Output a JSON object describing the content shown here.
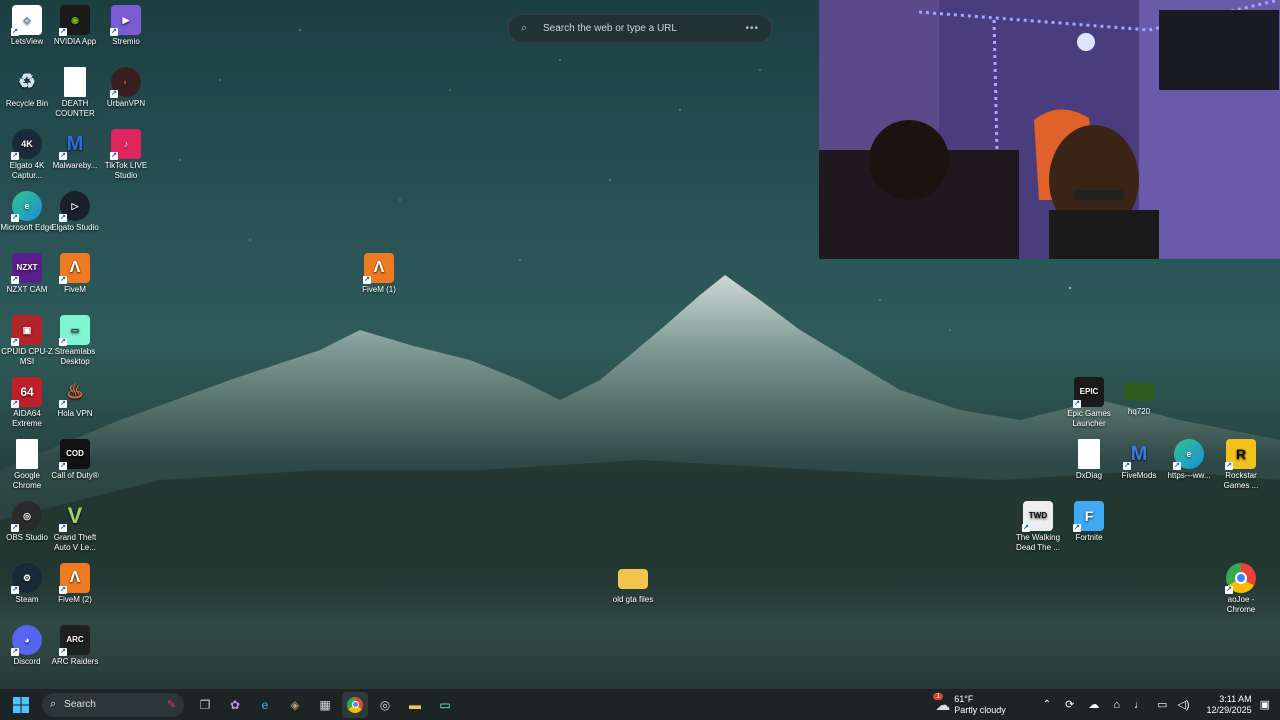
{
  "browser_search": {
    "placeholder": "Search the web or type a URL"
  },
  "desktop_icons": [
    {
      "id": "letsview",
      "label": "LetsView",
      "color": "#ffffff",
      "glyph": "◇"
    },
    {
      "id": "nvidia-app",
      "label": "NVIDIA App",
      "color": "#76b900",
      "glyph": "◉"
    },
    {
      "id": "stremio",
      "label": "Stremio",
      "color": "#7b5bd6",
      "glyph": "▶"
    },
    {
      "id": "recycle-bin",
      "label": "Recycle Bin",
      "color": "#9fb7c4",
      "glyph": "♻"
    },
    {
      "id": "death-counter",
      "label": "DEATH COUNTER",
      "color": "#ffffff",
      "glyph": ""
    },
    {
      "id": "urbanvpn",
      "label": "UrbanVPN",
      "color": "#3a1f1f",
      "glyph": "◐"
    },
    {
      "id": "elgato-4k",
      "label": "Elgato 4K Captur...",
      "color": "#1b2a3a",
      "glyph": "4K"
    },
    {
      "id": "malwarebytes",
      "label": "Malwareby...",
      "color": "#1f5bd6",
      "glyph": "M"
    },
    {
      "id": "tiktok-live",
      "label": "TikTok LIVE Studio",
      "color": "#e0245e",
      "glyph": "♪"
    },
    {
      "id": "microsoft-edge",
      "label": "Microsoft Edge",
      "color": "#1a8fd6",
      "glyph": "e"
    },
    {
      "id": "elgato-studio",
      "label": "Elgato Studio",
      "color": "#1b1f2a",
      "glyph": "▷"
    },
    {
      "id": "nzxt-cam",
      "label": "NZXT CAM",
      "color": "#5a1f8a",
      "glyph": "NZXT"
    },
    {
      "id": "fivem",
      "label": "FiveM",
      "color": "#f07a22",
      "glyph": "Λ"
    },
    {
      "id": "cpuid",
      "label": "CPUID CPU-Z MSI",
      "color": "#b2242a",
      "glyph": "▣"
    },
    {
      "id": "streamlabs",
      "label": "Streamlabs Desktop",
      "color": "#80f5d2",
      "glyph": "▭"
    },
    {
      "id": "aida64",
      "label": "AIDA64 Extreme",
      "color": "#c0202a",
      "glyph": "64"
    },
    {
      "id": "hola-vpn",
      "label": "Hola VPN",
      "color": "#f2683a",
      "glyph": "♨"
    },
    {
      "id": "google-chrome",
      "label": "Google Chrome",
      "color": "#ffffff",
      "glyph": ""
    },
    {
      "id": "call-of-duty",
      "label": "Call of Duty®",
      "color": "#111111",
      "glyph": "COD"
    },
    {
      "id": "obs-studio",
      "label": "OBS Studio",
      "color": "#2a2a2a",
      "glyph": "◎"
    },
    {
      "id": "gta-v",
      "label": "Grand Theft Auto V Le...",
      "color": "#1b2a1b",
      "glyph": "V"
    },
    {
      "id": "steam",
      "label": "Steam",
      "color": "#1b2838",
      "glyph": "⚙"
    },
    {
      "id": "fivem-2",
      "label": "FiveM (2)",
      "color": "#f07a22",
      "glyph": "Λ"
    },
    {
      "id": "discord",
      "label": "Discord",
      "color": "#5865f2",
      "glyph": "◕"
    },
    {
      "id": "arc-raiders",
      "label": "ARC Raiders",
      "color": "#202020",
      "glyph": "ARC"
    },
    {
      "id": "fivem-1",
      "label": "FiveM (1)",
      "color": "#f07a22",
      "glyph": "Λ"
    },
    {
      "id": "old-gta-files",
      "label": "old gta files",
      "color": "#f3c350",
      "glyph": ""
    },
    {
      "id": "epic-games",
      "label": "Epic Games Launcher",
      "color": "#1a1a1a",
      "glyph": "EPIC"
    },
    {
      "id": "hq720",
      "label": "hq720",
      "color": "#2e5a1c",
      "glyph": ""
    },
    {
      "id": "dxdiag",
      "label": "DxDiag",
      "color": "#ffffff",
      "glyph": ""
    },
    {
      "id": "fivemods",
      "label": "FiveMods",
      "color": "#2255cc",
      "glyph": "M"
    },
    {
      "id": "edge-url",
      "label": "https---ww...",
      "color": "#1a8fd6",
      "glyph": "e"
    },
    {
      "id": "rockstar",
      "label": "Rockstar Games ...",
      "color": "#f2c21a",
      "glyph": "R"
    },
    {
      "id": "walking-dead",
      "label": "The Walking Dead The ...",
      "color": "#eeeeee",
      "glyph": "TWD"
    },
    {
      "id": "fortnite",
      "label": "Fortnite",
      "color": "#3fa9f5",
      "glyph": "F"
    },
    {
      "id": "aojoe-chrome",
      "label": "aoJoe - Chrome",
      "color": "#ffffff",
      "glyph": ""
    }
  ],
  "taskbar": {
    "search_label": "Search",
    "weather_temp": "61°F",
    "weather_desc": "Partly cloudy",
    "weather_badge": "1",
    "time": "3:11 AM",
    "date": "12/29/2025"
  }
}
